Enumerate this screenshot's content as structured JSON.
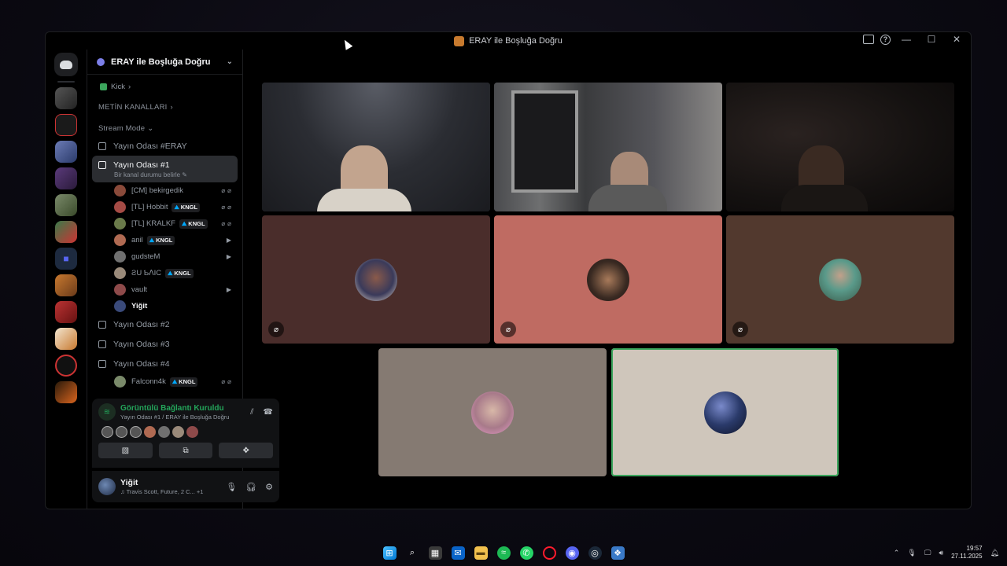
{
  "window": {
    "title": "ERAY ile Boşluğa Doğru"
  },
  "sidebar": {
    "guild_name": "ERAY ile Boşluğa Doğru",
    "kick_label": "Kick",
    "category_text": "METİN KANALLARI",
    "category_stream": "Stream Mode",
    "channels": [
      {
        "name": "Yayın Odası #ERAY"
      },
      {
        "name": "Yayın Odası #1",
        "status": "Bir kanal durumu belirle"
      },
      {
        "name": "Yayın Odası #2"
      },
      {
        "name": "Yayın Odası #3"
      },
      {
        "name": "Yayın Odası #4"
      }
    ],
    "voice_users": [
      {
        "name": "[CM] bekirgedik",
        "tag": "",
        "icons": "⌀⌀",
        "color": "#8a4a3a"
      },
      {
        "name": "[TL] Hobbit",
        "tag": "KNGL",
        "icons": "⌀⌀",
        "color": "#a54b45"
      },
      {
        "name": "[TL] KRALKF",
        "tag": "KNGL",
        "icons": "⌀⌀",
        "color": "#6a7a4a"
      },
      {
        "name": "anil",
        "tag": "KNGL",
        "icons": "▶",
        "color": "#b06a52"
      },
      {
        "name": "gudsteM",
        "tag": "",
        "icons": "▶",
        "color": "#707070"
      },
      {
        "name": "ƧU ƄꓥIC",
        "tag": "KNGL",
        "icons": "",
        "color": "#9a8a7a"
      },
      {
        "name": "vault",
        "tag": "",
        "icons": "▶",
        "color": "#8e4a4a"
      },
      {
        "name": "Yiğit",
        "tag": "",
        "icons": "",
        "color": "#3a4a7a"
      }
    ],
    "room4_users": [
      {
        "name": "Falconn4k",
        "tag": "KNGL",
        "icons": "⌀⌀",
        "color": "#7a8a6a"
      }
    ]
  },
  "voice_panel": {
    "title": "Görüntülü Bağlantı Kuruldu",
    "subtitle": "Yayın Odası #1 / ERAY ile Boşluğa Doğru"
  },
  "user_panel": {
    "name": "Yiğit",
    "status": "♫ Travis Scott, Future, 2 C... +1"
  },
  "taskbar": {
    "time": "19:57",
    "date": "27.11.2025"
  },
  "colors": {
    "accent_green": "#23a55a",
    "tile_1": "#4a2d2b",
    "tile_2": "#bf6b62",
    "tile_3": "#52392e",
    "tile_4": "#857a72",
    "tile_5": "#cfc6bb"
  }
}
